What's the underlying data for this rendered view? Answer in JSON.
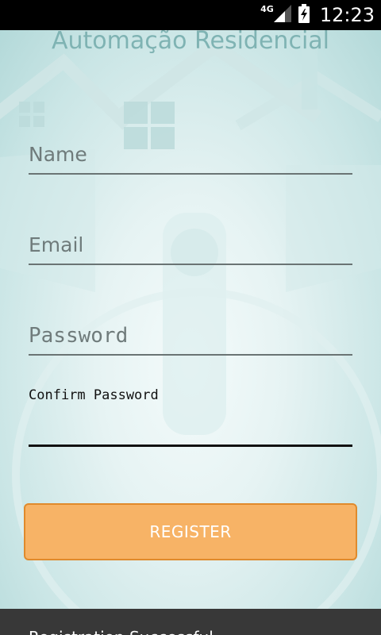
{
  "status_bar": {
    "network": "4G",
    "time": "12:23",
    "icons": [
      "signal-icon",
      "battery-charging-icon"
    ]
  },
  "app": {
    "title": "Automação Residencial"
  },
  "form": {
    "name_placeholder": "Name",
    "email_placeholder": "Email",
    "password_placeholder": "Password",
    "confirm_password_label": "Confirm Password",
    "register_label": "REGISTER"
  },
  "toast": {
    "message": "Registration Successful"
  },
  "colors": {
    "accent": "#f7b366",
    "accent_border": "#e08a2c",
    "background": "#d7ecec",
    "toast": "#383838"
  }
}
